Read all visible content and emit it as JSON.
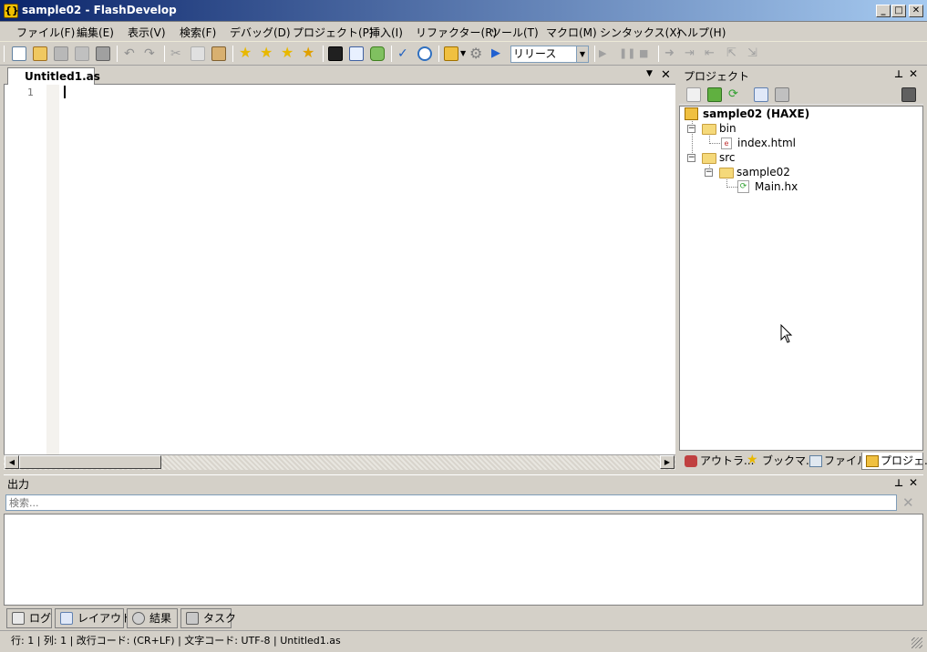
{
  "window": {
    "title": "sample02 - FlashDevelop",
    "app_icon": "{}",
    "minimize": "_",
    "maximize": "□",
    "close": "✕"
  },
  "menu": [
    "ファイル(F)",
    "編集(E)",
    "表示(V)",
    "検索(F)",
    "デバッグ(D)",
    "プロジェクト(P)",
    "挿入(I)",
    "リファクター(R)",
    "ツール(T)",
    "マクロ(M)",
    "シンタックス(X)",
    "ヘルプ(H)"
  ],
  "toolbar": {
    "config_value": "リリース"
  },
  "editor": {
    "tab_label": "Untitled1.as",
    "line_number": "1"
  },
  "project": {
    "panel_title": "プロジェクト",
    "root": "sample02 (HAXE)",
    "bin": "bin",
    "index_file": "index.html",
    "src": "src",
    "package": "sample02",
    "main_file": "Main.hx"
  },
  "side_tabs": [
    "アウトラ...",
    "ブックマ...",
    "ファイル",
    "プロジェ..."
  ],
  "output": {
    "title": "出力",
    "search_placeholder": "検索..."
  },
  "bottom_tabs": [
    "ログ",
    "レイアウト",
    "結果",
    "タスク"
  ],
  "status": {
    "text": "行: 1 | 列: 1 | 改行コード: (CR+LF) | 文字コード: UTF-8 | Untitled1.as"
  },
  "colors": {
    "titlebar_start": "#0a246a",
    "titlebar_end": "#a6caf0",
    "chrome": "#d4d0c8",
    "folder": "#f5d97a"
  }
}
